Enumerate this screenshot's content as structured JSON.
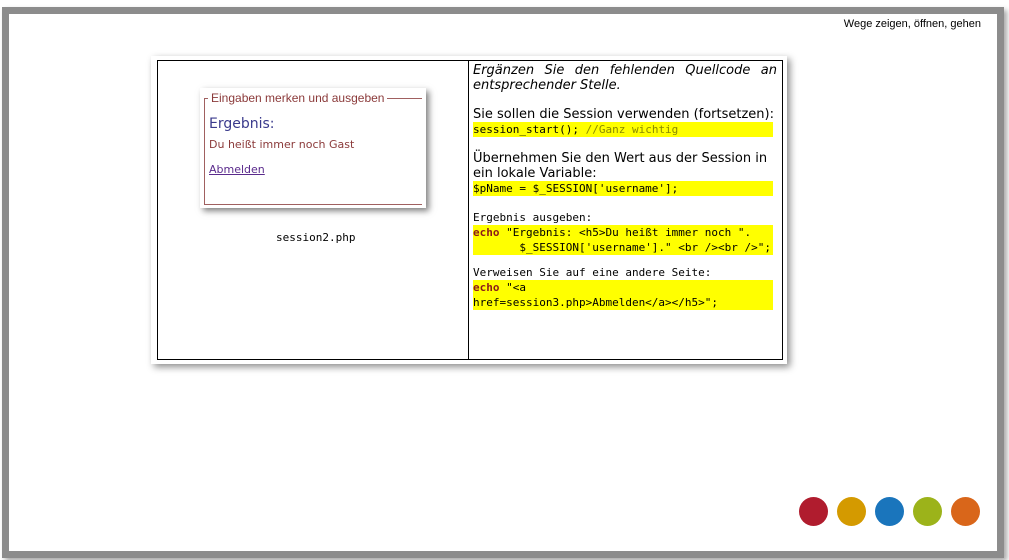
{
  "header": {
    "title": "Wege zeigen, öffnen, gehen"
  },
  "demo": {
    "legend": "Eingaben merken und ausgeben",
    "result_title": "Ergebnis:",
    "result_text": "Du heißt immer noch Gast",
    "link_label": "Abmelden",
    "caption": "session2.php"
  },
  "instructions": {
    "intro": "Ergänzen Sie den fehlenden Quellcode an entsprechender Stelle.",
    "step1_text": "Sie sollen die Session verwenden (fortsetzen):",
    "step1_code": "session_start();",
    "step1_comment": " //Ganz wichtig",
    "step2_text": "Übernehmen Sie den Wert aus der Session in ein lokale Variable:",
    "step2_code": "$pName = $_SESSION['username'];",
    "step3_text": "Ergebnis ausgeben:",
    "step3_kw": "echo",
    "step3_code_a": " \"Ergebnis: <h5>Du heißt immer noch \".",
    "step3_code_b": "       $_SESSION['username'].\" <br /><br />\";",
    "step4_text": "Verweisen Sie auf eine andere Seite:",
    "step4_kw": "echo",
    "step4_code_a": " \"<a",
    "step4_code_b": "href=session3.php>Abmelden</a></h5>\";"
  },
  "colors": {
    "dots": [
      "#b01c2e",
      "#d49a00",
      "#1a75bc",
      "#9cb31a",
      "#d9661a"
    ]
  }
}
